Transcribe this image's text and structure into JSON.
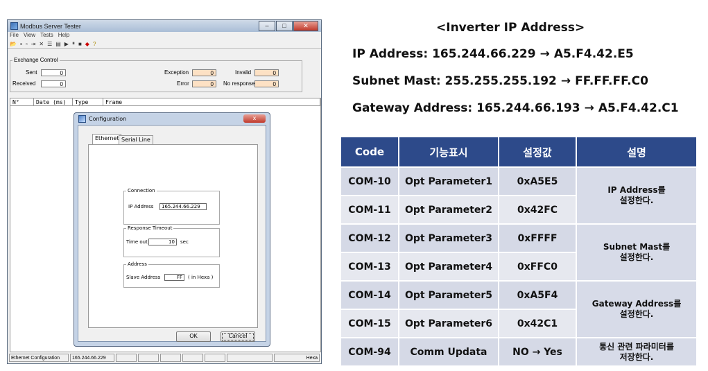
{
  "window": {
    "title": "Modbus Server Tester",
    "menu": [
      "File",
      "View",
      "Tests",
      "Help"
    ],
    "exchange": {
      "legend": "Exchange Control",
      "sent_label": "Sent",
      "sent_value": "0",
      "received_label": "Received",
      "received_value": "0",
      "exception_label": "Exception",
      "exception_value": "0",
      "invalid_label": "Invalid",
      "invalid_value": "0",
      "error_label": "Error",
      "error_value": "0",
      "noresponse_label": "No response",
      "noresponse_value": "0"
    },
    "list_headers": [
      "N°",
      "Date (ms)",
      "Type",
      "Frame"
    ],
    "status": [
      "Ethernet Configuration",
      "165.244.66.229",
      "",
      "",
      "",
      "",
      "",
      "",
      "Hexa"
    ]
  },
  "dialog": {
    "title": "Configuration",
    "close_label": "x",
    "tabs": [
      "Ethernet",
      "Serial Line"
    ],
    "connection": {
      "legend": "Connection",
      "ip_label": "IP Address",
      "ip_value": "165.244.66.229"
    },
    "timeout": {
      "legend": "Response Timeout",
      "label": "Time out",
      "value": "10",
      "unit": "sec"
    },
    "address": {
      "legend": "Address",
      "label": "Slave Address",
      "value": "FF",
      "suffix": "( in Hexa )"
    },
    "ok_label": "OK",
    "cancel_label": "Cancel"
  },
  "ip_info": {
    "title": "<Inverter IP Address>",
    "ip_line": "IP Address: 165.244.66.229",
    "ip_hex": "A5.F4.42.E5",
    "subnet_line": "Subnet Mast: 255.255.255.192",
    "subnet_hex": "FF.FF.FF.C0",
    "gateway_line": "Gateway Address: 165.244.66.193",
    "gateway_hex": "A5.F4.42.C1"
  },
  "table": {
    "headers": [
      "Code",
      "기능표시",
      "설정값",
      "설명"
    ],
    "rows": [
      {
        "code": "COM-10",
        "func": "Opt Parameter1",
        "value": "0xA5E5"
      },
      {
        "code": "COM-11",
        "func": "Opt Parameter2",
        "value": "0x42FC"
      },
      {
        "code": "COM-12",
        "func": "Opt Parameter3",
        "value": "0xFFFF"
      },
      {
        "code": "COM-13",
        "func": "Opt Parameter4",
        "value": "0xFFC0"
      },
      {
        "code": "COM-14",
        "func": "Opt Parameter5",
        "value": "0xA5F4"
      },
      {
        "code": "COM-15",
        "func": "Opt Parameter6",
        "value": "0x42C1"
      },
      {
        "code": "COM-94",
        "func": "Comm Updata",
        "value": "NO → Yes"
      }
    ],
    "descriptions": {
      "ip_1": "IP Address를",
      "ip_2": "설정한다.",
      "subnet_1": "Subnet Mast를",
      "subnet_2": "설정한다.",
      "gateway_1": "Gateway Address를",
      "gateway_2": "설정한다.",
      "comm_1": "통신 관련 파라미터를",
      "comm_2": "저장한다."
    }
  }
}
